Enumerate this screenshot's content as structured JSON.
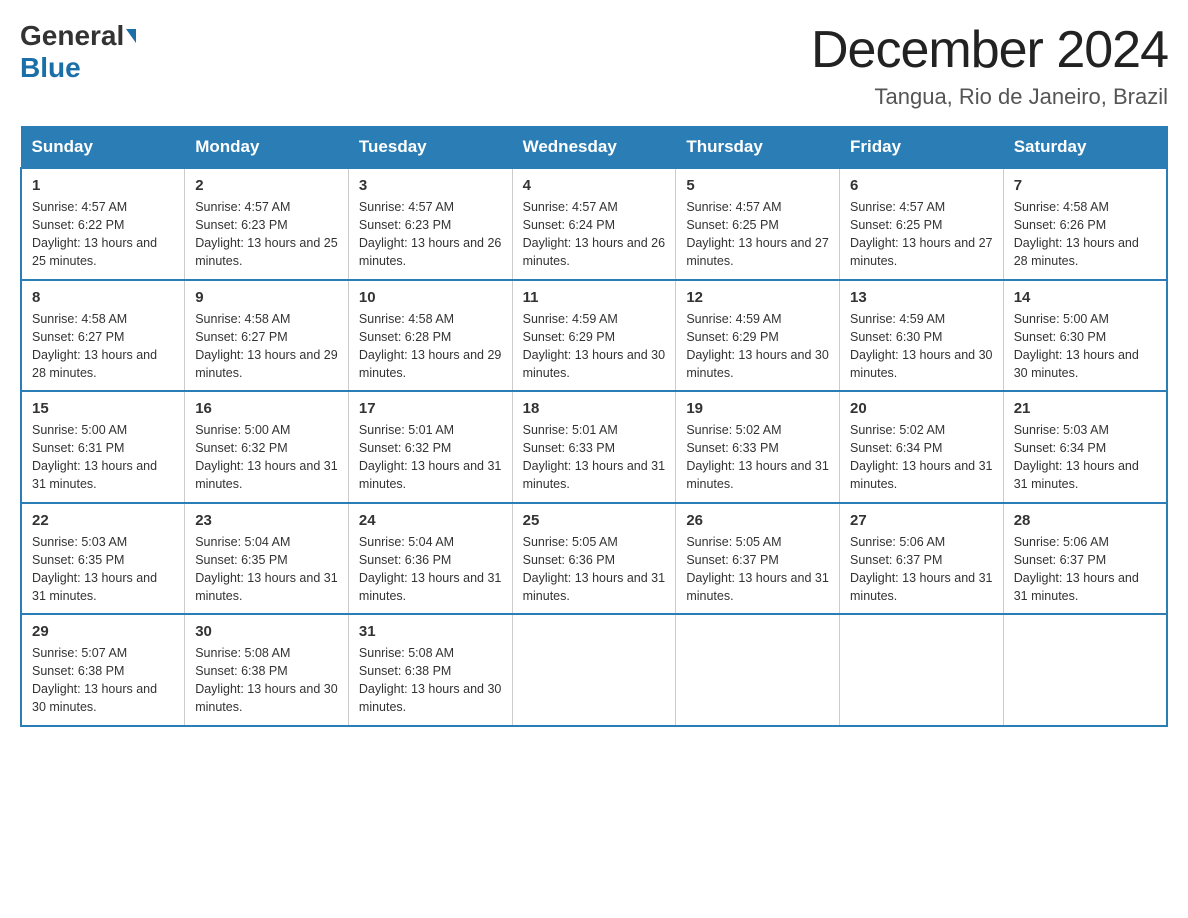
{
  "header": {
    "logo_general": "General",
    "logo_blue": "Blue",
    "month_title": "December 2024",
    "location": "Tangua, Rio de Janeiro, Brazil"
  },
  "days_of_week": [
    "Sunday",
    "Monday",
    "Tuesday",
    "Wednesday",
    "Thursday",
    "Friday",
    "Saturday"
  ],
  "weeks": [
    [
      {
        "day": "1",
        "sunrise": "4:57 AM",
        "sunset": "6:22 PM",
        "daylight": "13 hours and 25 minutes."
      },
      {
        "day": "2",
        "sunrise": "4:57 AM",
        "sunset": "6:23 PM",
        "daylight": "13 hours and 25 minutes."
      },
      {
        "day": "3",
        "sunrise": "4:57 AM",
        "sunset": "6:23 PM",
        "daylight": "13 hours and 26 minutes."
      },
      {
        "day": "4",
        "sunrise": "4:57 AM",
        "sunset": "6:24 PM",
        "daylight": "13 hours and 26 minutes."
      },
      {
        "day": "5",
        "sunrise": "4:57 AM",
        "sunset": "6:25 PM",
        "daylight": "13 hours and 27 minutes."
      },
      {
        "day": "6",
        "sunrise": "4:57 AM",
        "sunset": "6:25 PM",
        "daylight": "13 hours and 27 minutes."
      },
      {
        "day": "7",
        "sunrise": "4:58 AM",
        "sunset": "6:26 PM",
        "daylight": "13 hours and 28 minutes."
      }
    ],
    [
      {
        "day": "8",
        "sunrise": "4:58 AM",
        "sunset": "6:27 PM",
        "daylight": "13 hours and 28 minutes."
      },
      {
        "day": "9",
        "sunrise": "4:58 AM",
        "sunset": "6:27 PM",
        "daylight": "13 hours and 29 minutes."
      },
      {
        "day": "10",
        "sunrise": "4:58 AM",
        "sunset": "6:28 PM",
        "daylight": "13 hours and 29 minutes."
      },
      {
        "day": "11",
        "sunrise": "4:59 AM",
        "sunset": "6:29 PM",
        "daylight": "13 hours and 30 minutes."
      },
      {
        "day": "12",
        "sunrise": "4:59 AM",
        "sunset": "6:29 PM",
        "daylight": "13 hours and 30 minutes."
      },
      {
        "day": "13",
        "sunrise": "4:59 AM",
        "sunset": "6:30 PM",
        "daylight": "13 hours and 30 minutes."
      },
      {
        "day": "14",
        "sunrise": "5:00 AM",
        "sunset": "6:30 PM",
        "daylight": "13 hours and 30 minutes."
      }
    ],
    [
      {
        "day": "15",
        "sunrise": "5:00 AM",
        "sunset": "6:31 PM",
        "daylight": "13 hours and 31 minutes."
      },
      {
        "day": "16",
        "sunrise": "5:00 AM",
        "sunset": "6:32 PM",
        "daylight": "13 hours and 31 minutes."
      },
      {
        "day": "17",
        "sunrise": "5:01 AM",
        "sunset": "6:32 PM",
        "daylight": "13 hours and 31 minutes."
      },
      {
        "day": "18",
        "sunrise": "5:01 AM",
        "sunset": "6:33 PM",
        "daylight": "13 hours and 31 minutes."
      },
      {
        "day": "19",
        "sunrise": "5:02 AM",
        "sunset": "6:33 PM",
        "daylight": "13 hours and 31 minutes."
      },
      {
        "day": "20",
        "sunrise": "5:02 AM",
        "sunset": "6:34 PM",
        "daylight": "13 hours and 31 minutes."
      },
      {
        "day": "21",
        "sunrise": "5:03 AM",
        "sunset": "6:34 PM",
        "daylight": "13 hours and 31 minutes."
      }
    ],
    [
      {
        "day": "22",
        "sunrise": "5:03 AM",
        "sunset": "6:35 PM",
        "daylight": "13 hours and 31 minutes."
      },
      {
        "day": "23",
        "sunrise": "5:04 AM",
        "sunset": "6:35 PM",
        "daylight": "13 hours and 31 minutes."
      },
      {
        "day": "24",
        "sunrise": "5:04 AM",
        "sunset": "6:36 PM",
        "daylight": "13 hours and 31 minutes."
      },
      {
        "day": "25",
        "sunrise": "5:05 AM",
        "sunset": "6:36 PM",
        "daylight": "13 hours and 31 minutes."
      },
      {
        "day": "26",
        "sunrise": "5:05 AM",
        "sunset": "6:37 PM",
        "daylight": "13 hours and 31 minutes."
      },
      {
        "day": "27",
        "sunrise": "5:06 AM",
        "sunset": "6:37 PM",
        "daylight": "13 hours and 31 minutes."
      },
      {
        "day": "28",
        "sunrise": "5:06 AM",
        "sunset": "6:37 PM",
        "daylight": "13 hours and 31 minutes."
      }
    ],
    [
      {
        "day": "29",
        "sunrise": "5:07 AM",
        "sunset": "6:38 PM",
        "daylight": "13 hours and 30 minutes."
      },
      {
        "day": "30",
        "sunrise": "5:08 AM",
        "sunset": "6:38 PM",
        "daylight": "13 hours and 30 minutes."
      },
      {
        "day": "31",
        "sunrise": "5:08 AM",
        "sunset": "6:38 PM",
        "daylight": "13 hours and 30 minutes."
      },
      null,
      null,
      null,
      null
    ]
  ]
}
